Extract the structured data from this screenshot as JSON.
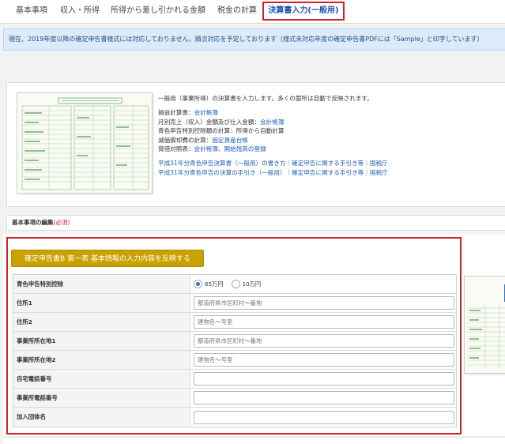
{
  "tabs": [
    {
      "label": "基本事項",
      "active": false
    },
    {
      "label": "収入・所得",
      "active": false
    },
    {
      "label": "所得から差し引かれる金額",
      "active": false
    },
    {
      "label": "税金の計算",
      "active": false
    },
    {
      "label": "決算書入力(一般用)",
      "active": true
    }
  ],
  "notice": {
    "text": "現在、2019年度以降の確定申告書様式には対応しておりません。順次対応を予定しております（様式未対応年度の確定申告書PDFには「Sample」と印字しています）"
  },
  "intro": {
    "description": "一般用（事業所得）の決算書を入力します。多くの箇所は自動で反映されます。",
    "items": [
      {
        "text": "損益計算書：",
        "link": "会計帳簿",
        "suffix": ""
      },
      {
        "text": "月別売上（収入）金額及び仕入金額：",
        "link": "会計帳簿",
        "suffix": ""
      },
      {
        "text": "青色申告特別控除額の計算：所得から自動計算",
        "link": "",
        "suffix": ""
      },
      {
        "text": "減価償却費の計算：",
        "link": "固定資産台帳",
        "suffix": ""
      },
      {
        "text": "貸借対照表：",
        "link": "会計帳簿、開始残高の登録",
        "suffix": ""
      }
    ],
    "links": [
      "平成31年分青色申告決算書（一般用）の書き方｜確定申告に関する手引き等｜国税庁",
      "平成31年分青色申告の決算の手引き（一般用）｜確定申告に関する手引き等｜国税庁"
    ]
  },
  "section": {
    "title": "基本事項の編集",
    "required": "(必須)"
  },
  "form": {
    "reflect_button": "確定申告書B 第一表 基本情報の入力内容を反映する",
    "rows": [
      {
        "label": "青色申告特別控除",
        "type": "radio",
        "options": [
          "65万円",
          "10万円"
        ],
        "selected": "65万円"
      },
      {
        "label": "住所1",
        "type": "input",
        "value": "",
        "placeholder": "都道府県市区町村〜番地"
      },
      {
        "label": "住所2",
        "type": "input",
        "value": "",
        "placeholder": "建物名〜号室"
      },
      {
        "label": "事業所所在地1",
        "type": "input",
        "value": "",
        "placeholder": "都道府県市区町村〜番地"
      },
      {
        "label": "事業所所在地2",
        "type": "input",
        "value": "",
        "placeholder": "建物名〜号室"
      },
      {
        "label": "自宅電話番号",
        "type": "input",
        "value": "",
        "placeholder": ""
      },
      {
        "label": "事業所電話番号",
        "type": "input",
        "value": "",
        "placeholder": ""
      },
      {
        "label": "加入団体名",
        "type": "input",
        "value": "",
        "placeholder": ""
      }
    ]
  },
  "colors": {
    "active_tab_border": "#d0202a",
    "active_tab_text": "#1a56b4",
    "link": "#1f5fb5",
    "notice_bg": "#dcebfa",
    "button_bg": "#c9a100",
    "required": "#d0202a",
    "form_green": "#3a9a3a"
  }
}
